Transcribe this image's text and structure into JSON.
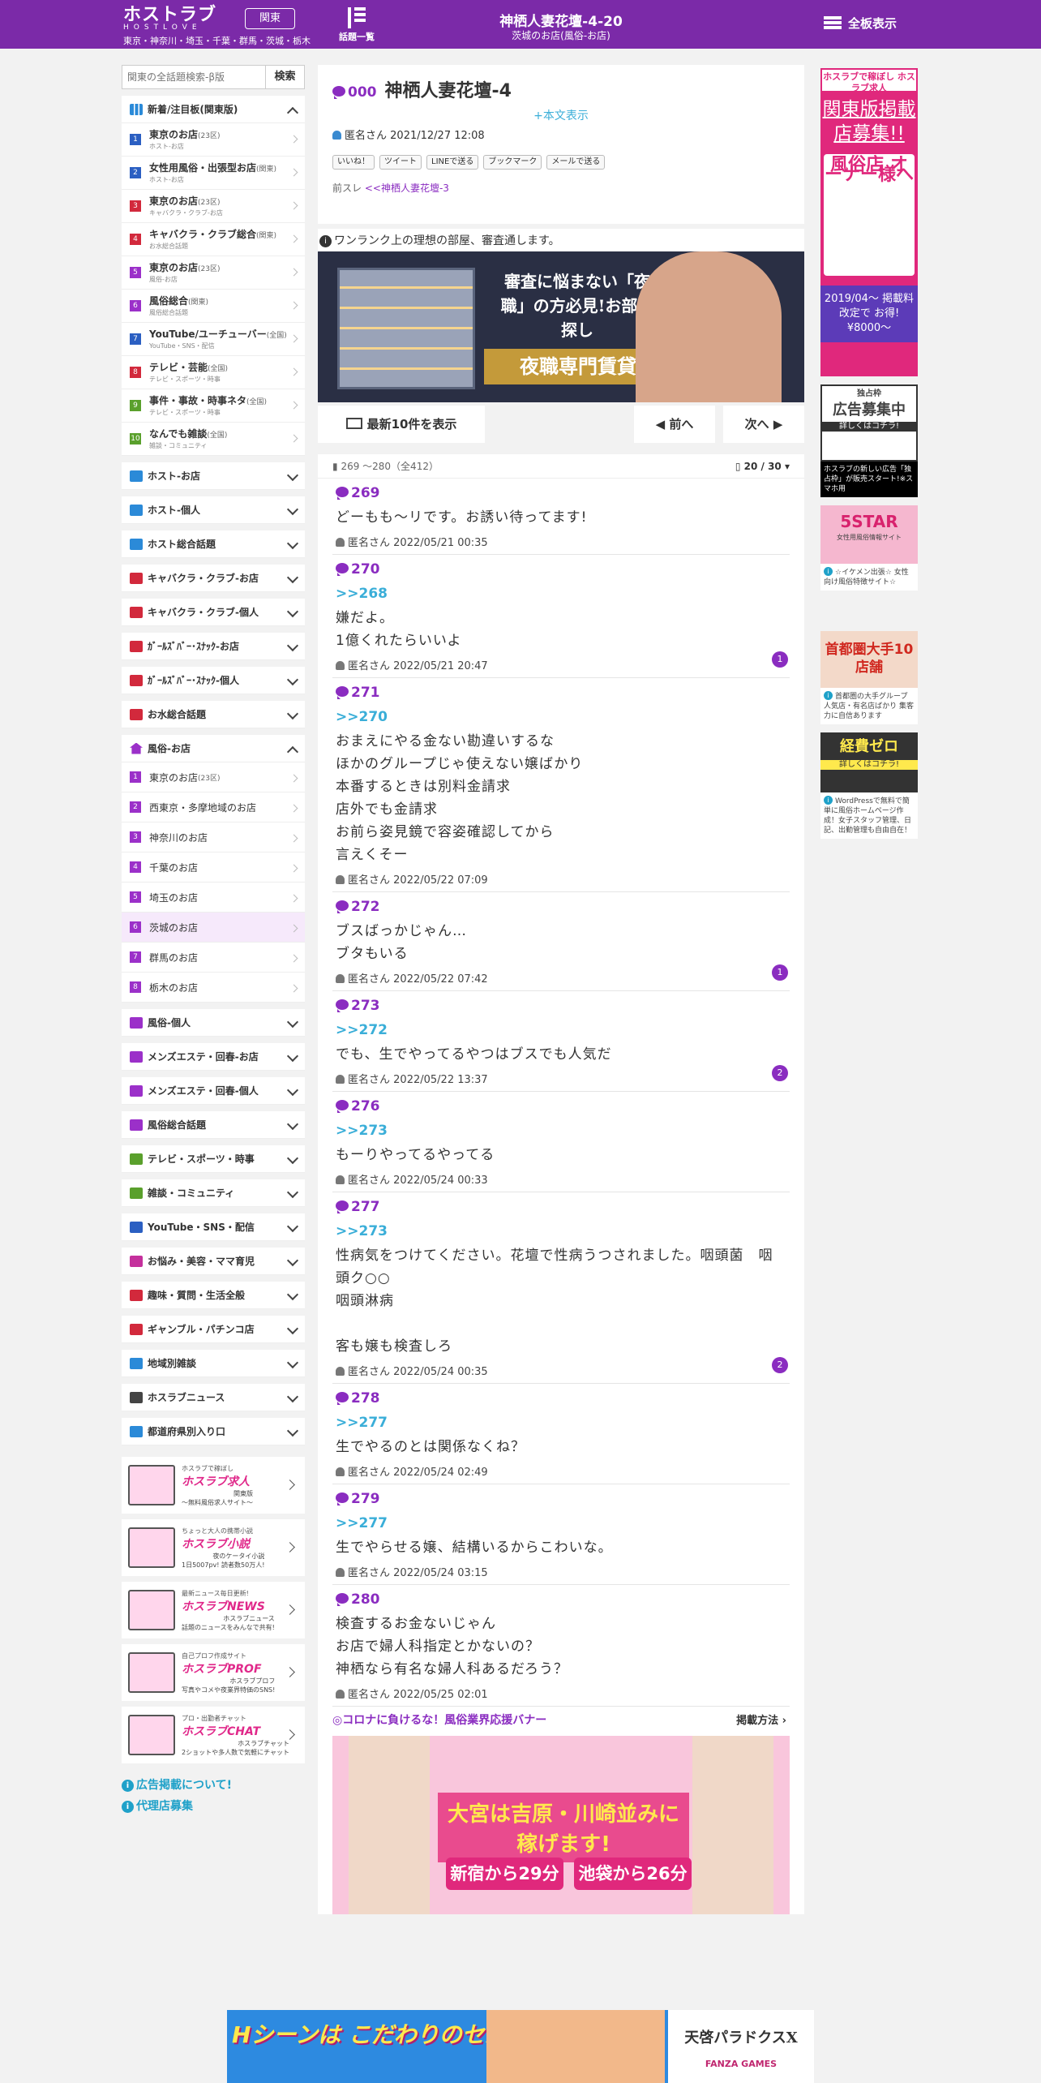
{
  "header": {
    "logo": "ホストラブ",
    "logo_sub": "HOSTLOVE",
    "area_button": "関東",
    "area_list": "東京・神奈川・埼玉・千葉・群馬・茨城・栃木",
    "topics_label": "話題一覧",
    "title": "神栖人妻花壇-4-20",
    "subtitle": "茨城のお店(風俗-お店)",
    "all_boards": "全板表示"
  },
  "search": {
    "placeholder": "関東の全話題検索-β版",
    "button": "検索"
  },
  "sidebar": {
    "new_header": "新着/注目板(関東版)",
    "new_items": [
      {
        "n": "1",
        "title": "東京のお店",
        "tag": "(23区)",
        "sub": "ホスト-お店",
        "color": "#2b5fc2"
      },
      {
        "n": "2",
        "title": "女性用風俗・出張型お店",
        "tag": "(関東)",
        "sub": "ホスト-お店",
        "color": "#2b5fc2"
      },
      {
        "n": "3",
        "title": "東京のお店",
        "tag": "(23区)",
        "sub": "キャバクラ・クラブ-お店",
        "color": "#d2293c"
      },
      {
        "n": "4",
        "title": "キャバクラ・クラブ総合",
        "tag": "(関東)",
        "sub": "お水総合話題",
        "color": "#d2293c"
      },
      {
        "n": "5",
        "title": "東京のお店",
        "tag": "(23区)",
        "sub": "風俗-お店",
        "color": "#9b30c9"
      },
      {
        "n": "6",
        "title": "風俗総合",
        "tag": "(関東)",
        "sub": "風俗総合話題",
        "color": "#9b30c9"
      },
      {
        "n": "7",
        "title": "YouTube/ユーチューバー",
        "tag": "(全国)",
        "sub": "YouTube・SNS・配信",
        "color": "#2b5fc2"
      },
      {
        "n": "8",
        "title": "テレビ・芸能",
        "tag": "(全国)",
        "sub": "テレビ・スポーツ・時事",
        "color": "#d2293c"
      },
      {
        "n": "9",
        "title": "事件・事故・時事ネタ",
        "tag": "(全国)",
        "sub": "テレビ・スポーツ・時事",
        "color": "#5aa02c"
      },
      {
        "n": "10",
        "title": "なんでも雑談",
        "tag": "(全国)",
        "sub": "雑談・コミュニティ",
        "color": "#5aa02c"
      }
    ],
    "cats1": [
      {
        "label": "ホスト-お店",
        "color": "#2b8ad8"
      },
      {
        "label": "ホスト-個人",
        "color": "#2b8ad8"
      },
      {
        "label": "ホスト総合話題",
        "color": "#2b8ad8"
      },
      {
        "label": "キャバクラ・クラブ-お店",
        "color": "#d2293c"
      },
      {
        "label": "キャバクラ・クラブ-個人",
        "color": "#d2293c"
      },
      {
        "label": "ｶﾞｰﾙｽﾞﾊﾞｰ･ｽﾅｯｸ-お店",
        "color": "#d2293c"
      },
      {
        "label": "ｶﾞｰﾙｽﾞﾊﾞｰ･ｽﾅｯｸ-個人",
        "color": "#d2293c"
      },
      {
        "label": "お水総合話題",
        "color": "#d2293c"
      }
    ],
    "fuzoku_header": "風俗-お店",
    "fuzoku_items": [
      {
        "n": "1",
        "label": "東京のお店",
        "tag": "(23区)"
      },
      {
        "n": "2",
        "label": "西東京・多摩地域のお店",
        "tag": ""
      },
      {
        "n": "3",
        "label": "神奈川のお店",
        "tag": ""
      },
      {
        "n": "4",
        "label": "千葉のお店",
        "tag": ""
      },
      {
        "n": "5",
        "label": "埼玉のお店",
        "tag": ""
      },
      {
        "n": "6",
        "label": "茨城のお店",
        "tag": ""
      },
      {
        "n": "7",
        "label": "群馬のお店",
        "tag": ""
      },
      {
        "n": "8",
        "label": "栃木のお店",
        "tag": ""
      }
    ],
    "cats2": [
      {
        "label": "風俗-個人",
        "color": "#9b30c9"
      },
      {
        "label": "メンズエステ・回春-お店",
        "color": "#9b30c9"
      },
      {
        "label": "メンズエステ・回春-個人",
        "color": "#9b30c9"
      },
      {
        "label": "風俗総合話題",
        "color": "#9b30c9"
      },
      {
        "label": "テレビ・スポーツ・時事",
        "color": "#5aa02c"
      },
      {
        "label": "雑談・コミュニティ",
        "color": "#5aa02c"
      },
      {
        "label": "YouTube・SNS・配信",
        "color": "#2b5fc2"
      },
      {
        "label": "お悩み・美容・ママ育児",
        "color": "#c4309c"
      },
      {
        "label": "趣味・質問・生活全般",
        "color": "#d2293c"
      },
      {
        "label": "ギャンブル・パチンコ店",
        "color": "#d2293c"
      },
      {
        "label": "地域別雑談",
        "color": "#2b8ad8"
      },
      {
        "label": "ホスラブニュース",
        "color": "#444444"
      },
      {
        "label": "都道府県別入り口",
        "color": "#2b8ad8"
      }
    ],
    "promos": [
      {
        "t1": "ホスラブで稼ぼし",
        "t2": "ホスラブ求人",
        "t3": "～無料風俗求人サイト～",
        "x": "関東版"
      },
      {
        "t1": "ちょっと大人の携帯小説",
        "t2": "ホスラブ小説",
        "t3": "1日5007pv! 読者数50万人!",
        "x": "夜のケータイ小説"
      },
      {
        "t1": "最新ニュース毎日更新!",
        "t2": "ホスラブNEWS",
        "t3": "話題のニュースをみんなで共有!",
        "x": "ホスラブニュース"
      },
      {
        "t1": "自己プロフ作成サイト",
        "t2": "ホスラブPROF",
        "t3": "写真やコメや夜業界特価のSNS!",
        "x": "ホスラブプロフ"
      },
      {
        "t1": "プロ・出勤者チャット",
        "t2": "ホスラブCHAT",
        "t3": "2ショットや多人数で気軽にチャット",
        "x": "ホスラブチャット"
      }
    ],
    "link1": "広告掲載について!",
    "link2": "代理店募集"
  },
  "thread": {
    "id": "000",
    "title": "神栖人妻花壇-4",
    "show_body": "+本文表示",
    "author": "匿名さん",
    "date": "2021/12/27 12:08",
    "shares": [
      "いいね！",
      "ツイート",
      "LINEで送る",
      "ブックマーク",
      "メールで送る"
    ],
    "prev_label": "前スレ",
    "prev_link": "<<神栖人妻花壇-3"
  },
  "notice": {
    "text": "ワンランク上の理想の部屋、審査通します。",
    "copy": "審査に悩まない「夜職」の方必見!お部屋探し",
    "gold": "夜職専門賃貸"
  },
  "nav": {
    "latest": "最新10件を表示",
    "prev": "前へ",
    "next": "次へ"
  },
  "posts_header": {
    "range": "269 ～280（全412）",
    "page": "20 / 30"
  },
  "posts": [
    {
      "no": "269",
      "anchor": "",
      "body": "どーもも〜リです。お誘い待ってます!",
      "author": "匿名さん",
      "date": "2022/05/21 00:35",
      "badge": ""
    },
    {
      "no": "270",
      "anchor": ">>268",
      "body": "嫌だよ。\n1億くれたらいいよ",
      "author": "匿名さん",
      "date": "2022/05/21 20:47",
      "badge": "1"
    },
    {
      "no": "271",
      "anchor": ">>270",
      "body": "おまえにやる金ない勘違いするな\nほかのグループじゃ使えない嬢ばかり\n本番するときは別料金請求\n店外でも金請求\nお前ら姿見鏡で容姿確認してから\n言えくそー",
      "author": "匿名さん",
      "date": "2022/05/22 07:09",
      "badge": ""
    },
    {
      "no": "272",
      "anchor": "",
      "body": "ブスばっかじゃん…\nブタもいる",
      "author": "匿名さん",
      "date": "2022/05/22 07:42",
      "badge": "1"
    },
    {
      "no": "273",
      "anchor": ">>272",
      "body": "でも、生でやってるやつはブスでも人気だ",
      "author": "匿名さん",
      "date": "2022/05/22 13:37",
      "badge": "2"
    },
    {
      "no": "276",
      "anchor": ">>273",
      "body": "もーりやってるやってる",
      "author": "匿名さん",
      "date": "2022/05/24 00:33",
      "badge": ""
    },
    {
      "no": "277",
      "anchor": ">>273",
      "body": "性病気をつけてください。花壇で性病うつされました。咽頭菌　咽頭ク○○\n咽頭淋病\n\n客も嬢も検査しろ",
      "author": "匿名さん",
      "date": "2022/05/24 00:35",
      "badge": "2"
    },
    {
      "no": "278",
      "anchor": ">>277",
      "body": "生でやるのとは関係なくね？",
      "author": "匿名さん",
      "date": "2022/05/24 02:49",
      "badge": ""
    },
    {
      "no": "279",
      "anchor": ">>277",
      "body": "生でやらせる嬢、結構いるからこわいな。",
      "author": "匿名さん",
      "date": "2022/05/24 03:15",
      "badge": ""
    },
    {
      "no": "280",
      "anchor": "",
      "body": "検査するお金ないじゃん\nお店で婦人科指定とかないの？\n神栖なら有名な婦人科あるだろう？",
      "author": "匿名さん",
      "date": "2022/05/25 02:01",
      "badge": ""
    }
  ],
  "corona": {
    "title": "◎コロナに負けるな！風俗業界応援バナー",
    "how": "掲載方法"
  },
  "banner2": {
    "main": "大宮は吉原・川崎並みに稼げます!",
    "b1": "新宿から29分",
    "b2": "池袋から26分"
  },
  "right_ads": {
    "kanto_top": "ホスラブで稼ぼし ホスラブ求人",
    "kanto_big": "関東版掲載店募集!!",
    "kanto_mid": "風俗店 オーナー様へ",
    "kanto_foot": "2019/04〜 掲載料改定で お得!¥8000〜",
    "ad2_title": "独占枠",
    "ad2_main": "広告募集中",
    "ad2_sub": "詳しくはコチラ!",
    "ad2_text": "ホスラブの新しい広告「独占枠」が販売スタート!※スマホ用",
    "ad3_main": "5STAR",
    "ad3_sub": "女性用風俗情報サイト",
    "ad3_text": "☆イケメン出張☆ 女性向け風俗特徴サイト☆",
    "ad4_main": "首都圏大手10店舗",
    "ad4_text": "首都圏の大手グループ人気店・有名店ばかり 集客力に自信あります",
    "ad5_main": "経費ゼロ",
    "ad5_sub": "詳しくはコチラ!",
    "ad5_text": "WordPressで無料で簡単に風俗ホームページ作成！女子スタッフ管理、日記、出勤管理も自由自在！"
  },
  "bottom_banner": {
    "left": "Hシーンは こだわりのセルアニメ!",
    "right": "天啓パラドクスX",
    "brand": "FANZA GAMES"
  }
}
